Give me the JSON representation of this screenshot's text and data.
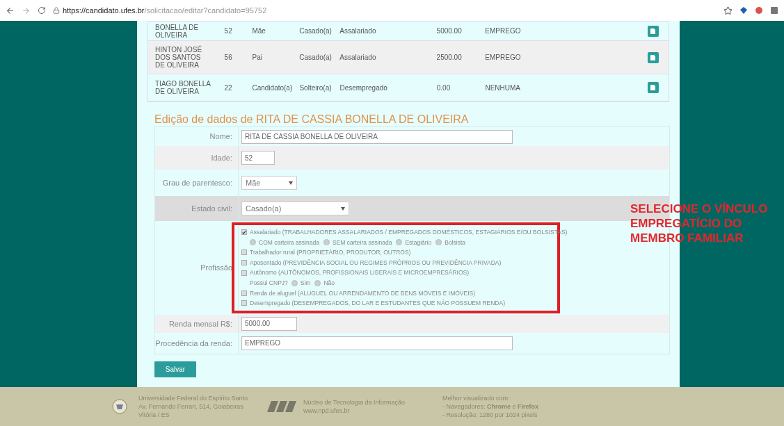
{
  "browser": {
    "url_host": "https://candidato.ufes.br",
    "url_path": "/solicitacao/editar?candidato=95752"
  },
  "members": [
    {
      "name": "BONELLA DE OLIVEIRA",
      "age": "52",
      "relation": "Mãe",
      "civil": "Casado(a)",
      "profession": "Assalariado",
      "income": "5000.00",
      "source": "EMPREGO"
    },
    {
      "name": "HINTON JOSÉ DOS SANTOS DE OLIVEIRA",
      "age": "56",
      "relation": "Pai",
      "civil": "Casado(a)",
      "profession": "Assalariado",
      "income": "2500.00",
      "source": "EMPREGO"
    },
    {
      "name": "TIAGO BONELLA DE OLIVEIRA",
      "age": "22",
      "relation": "Candidato(a)",
      "civil": "Solteiro(a)",
      "profession": "Desempregado",
      "income": "0.00",
      "source": "NENHUMA"
    }
  ],
  "form": {
    "title": "Edição de dados de RITA DE CASSIA BONELLA DE OLIVEIRA",
    "fields": [
      {
        "kind": "text",
        "label": "Nome:",
        "value": "RITA DE CASSIA BONELLA DE OLIVEIRA"
      },
      {
        "kind": "text",
        "label": "Idade:",
        "value": "52"
      },
      {
        "kind": "select",
        "label": "Grau de parentesco:",
        "value": "Mãe"
      },
      {
        "kind": "select",
        "label": "Estado civil:",
        "value": "Casado(a)"
      },
      {
        "kind": "options",
        "label": "Profissão",
        "options": [
          {
            "label": "Assalariado (TRABALHADORES ASSALARIADOS / EMPREGADOS DOMÉSTICOS, ESTAGIÁRIOS E/OU BOLSISTAS)",
            "checked": true,
            "choices": [
              {
                "label": "COM carteira assinada",
                "selected": false
              },
              {
                "label": "SEM carteira assinada",
                "selected": false
              },
              {
                "label": "Estagiário",
                "selected": false
              },
              {
                "label": "Bolsista",
                "selected": false
              }
            ]
          },
          {
            "label": "Trabalhador rural (PROPRIETÁRIO, PRODUTOR, OUTROS)",
            "checked": false
          },
          {
            "label": "Aposentado (PREVIDÊNCIA SOCIAL OU REGIMES PRÓPRIOS OU PREVIDÊNCIA PRIVADA)",
            "checked": false
          },
          {
            "label": "Autônomo (AUTÔNOMOS, PROFISSIONAIS LIBERAIS E MICROEMPRESÁRIOS)",
            "checked": false,
            "question": "Possui CNPJ?",
            "choices": [
              {
                "label": "Sim",
                "selected": false
              },
              {
                "label": "Não",
                "selected": false
              }
            ]
          },
          {
            "label": "Renda de aluguel (ALUGUEL OU ARRENDAMENTO DE BENS MÓVEIS E IMÓVEIS)",
            "checked": false
          },
          {
            "label": "Desempregado (DESEMPREGADOS, DO LAR E ESTUDANTES QUE NÃO POSSUEM RENDA)",
            "checked": false
          }
        ]
      },
      {
        "kind": "text",
        "label": "Renda mensal R$:",
        "value": "5000.00"
      },
      {
        "kind": "text",
        "label": "Procedência da renda:",
        "value": "EMPREGO"
      }
    ],
    "submit": "Salvar"
  },
  "annotation": [
    "SELECIONE O VÍNCULO",
    "EMPREGATÍCIO DO",
    "MEMBRO FAMILIAR"
  ],
  "footer": {
    "university": [
      "Universidade Federal do Espírito Santo",
      "Av. Fernando Ferrari, 514, Goiabeiras",
      "Vitória / ES"
    ],
    "npd": [
      "Núcleo de Tecnologia da Informação",
      "www.npd.ufes.br"
    ],
    "notes": [
      "Melhor visualizado com:",
      "- Navegadores: **Chrome** e **Firefox**",
      "- Resolução: 1280 por 1024 pixels"
    ]
  }
}
